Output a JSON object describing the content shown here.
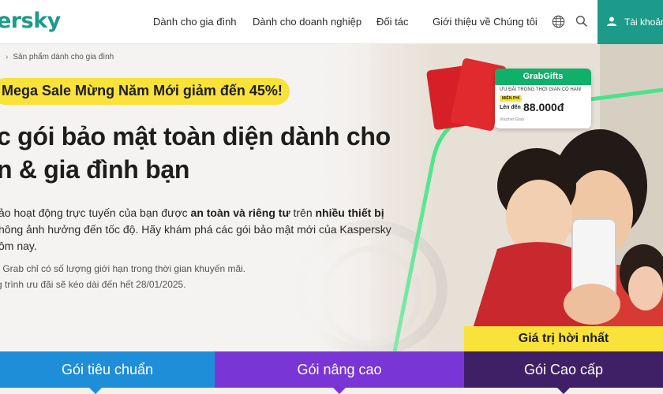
{
  "nav": {
    "logo_text": "ersky",
    "links": [
      "Dành cho gia đình",
      "Dành cho doanh nghiệp",
      "Đối tác",
      "Giới thiệu về Chúng tôi"
    ],
    "globe_icon": "globe-icon",
    "search_icon": "search-icon",
    "account_label": "Tài khoản",
    "accent_color": "#1d9b8a"
  },
  "hero": {
    "breadcrumb": "Sản phẩm dành cho gia đình",
    "promo": "Mega Sale Mừng Năm Mới giảm đến 45%!",
    "headline_line1": "c gói bảo mật toàn diện dành cho",
    "headline_line2": "n & gia đình bạn",
    "desc": {
      "l1_a": "ảo hoạt động trực tuyến của bạn được ",
      "l1_b": "an toàn và riêng tư",
      "l1_c": " trên ",
      "l1_d": "nhiều thiết bị",
      "l2": "hông ảnh hưởng đến tốc độ. Hãy khám phá các gói bảo mật mới của Kaspersky",
      "l3": "ôm nay."
    },
    "note1": "r Grab chỉ có số lượng giới hạn trong thời gian khuyến mãi.",
    "note2": "g trình ưu đãi sẽ kéo dài đến hết 28/01/2025.",
    "grab": {
      "title": "GrabGifts",
      "subtitle": "ƯU ĐÃI TRONG THỜI GIAN CÓ HẠN!",
      "free": "MIỄN PHÍ",
      "upto": "Lên đến",
      "amount": "88.000đ",
      "fine": "Voucher Grab"
    },
    "best_value": "Giá trị hời nhất"
  },
  "tabs": [
    {
      "label": "Gói tiêu chuẩn",
      "color": "#1e8ed8"
    },
    {
      "label": "Gói nâng cao",
      "color": "#7a35d6"
    },
    {
      "label": "Gói Cao cấp",
      "color": "#3f1f66"
    }
  ]
}
